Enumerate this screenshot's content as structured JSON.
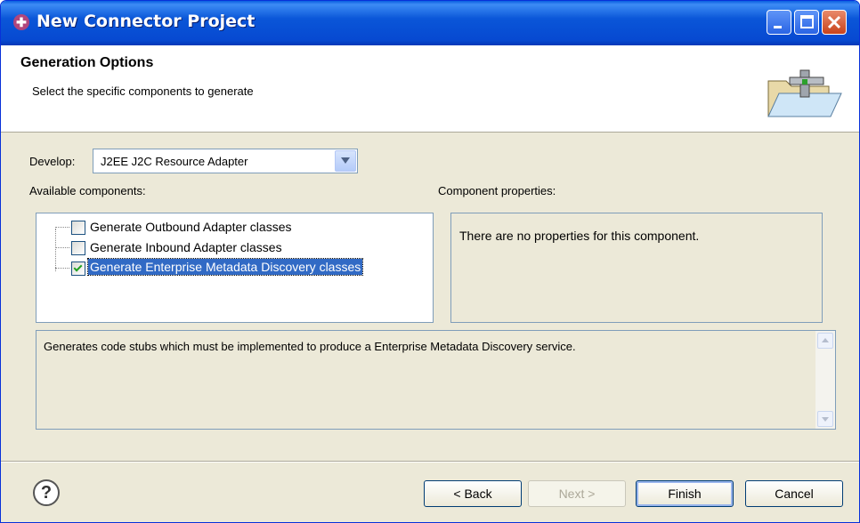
{
  "window": {
    "title": "New Connector Project"
  },
  "banner": {
    "title": "Generation Options",
    "message": "Select the specific components to generate"
  },
  "develop": {
    "label": "Develop:",
    "selected": "J2EE J2C Resource Adapter"
  },
  "available": {
    "label": "Available components:",
    "items": [
      {
        "label": "Generate Outbound Adapter classes",
        "checked": false
      },
      {
        "label": "Generate Inbound Adapter classes",
        "checked": false
      },
      {
        "label": "Generate Enterprise Metadata Discovery classes",
        "checked": true,
        "selected": true
      }
    ]
  },
  "properties": {
    "label": "Component properties:",
    "empty_text": "There are no properties for this component."
  },
  "description": "Generates code stubs which must be implemented to produce a Enterprise Metadata Discovery service.",
  "buttons": {
    "help": "?",
    "back": "< Back",
    "next": "Next >",
    "finish": "Finish",
    "cancel": "Cancel"
  }
}
